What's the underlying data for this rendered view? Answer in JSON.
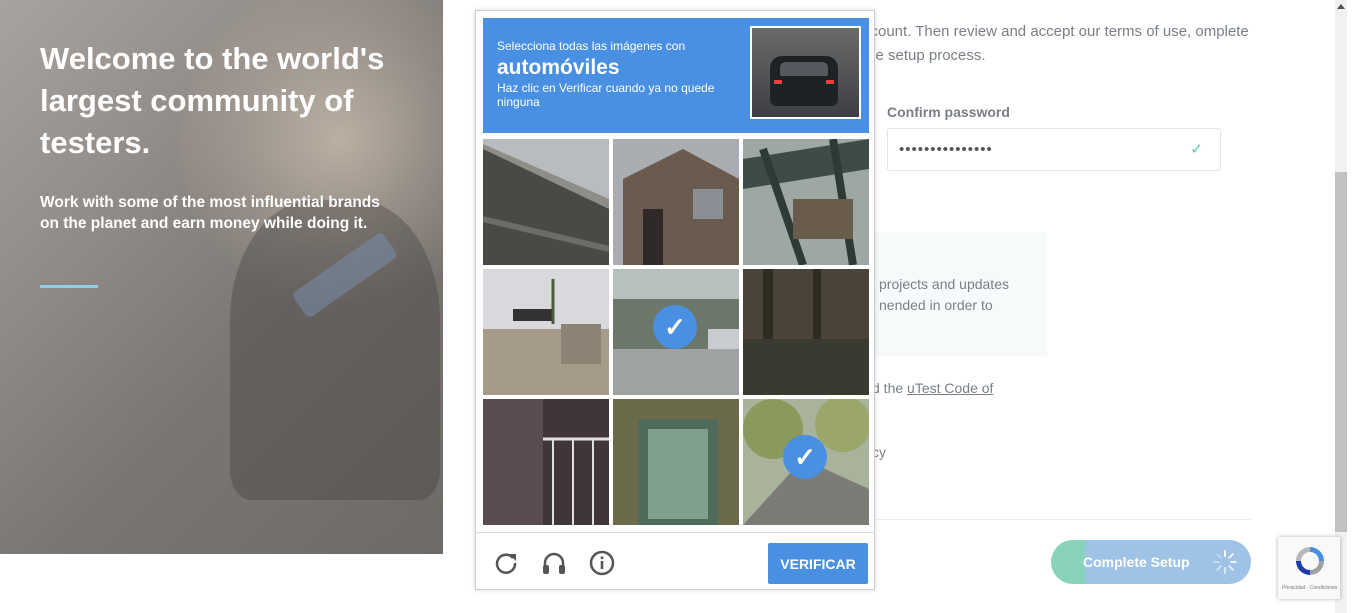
{
  "hero": {
    "title": "Welcome to the world's largest community of testers.",
    "subtitle": "Work with some of the most influential brands on the planet and earn money while doing it."
  },
  "form": {
    "intro": "ccount. Then review and accept our terms of use, omplete the setup process.",
    "confirm_password_label": "Confirm password",
    "confirm_password_value": "•••••••••••••••",
    "notice_text": "projects and updates nended in order to",
    "terms_prefix": "d the ",
    "terms_link": "uTest Code of",
    "privacy_fragment": "cy",
    "complete_setup_label": "Complete Setup"
  },
  "captcha": {
    "instruction_line1": "Selecciona todas las imágenes con",
    "keyword": "automóviles",
    "instruction_line2": "Haz clic en Verificar cuando ya no quede ninguna",
    "verify_label": "VERIFICAR",
    "tiles": [
      {
        "desc": "overpass",
        "selected": false
      },
      {
        "desc": "building",
        "selected": false
      },
      {
        "desc": "bridge",
        "selected": false
      },
      {
        "desc": "street-palms",
        "selected": false
      },
      {
        "desc": "parking-car",
        "selected": true
      },
      {
        "desc": "dark-trees",
        "selected": false
      },
      {
        "desc": "stairs-railing",
        "selected": false
      },
      {
        "desc": "door",
        "selected": false
      },
      {
        "desc": "street-trees",
        "selected": true
      }
    ]
  },
  "badge": {
    "terms": "Privacidad - Condiciones"
  },
  "colors": {
    "captcha_blue": "#4a90e2",
    "accent_green": "#53c7a3",
    "hero_rule": "#8ecfe6"
  }
}
